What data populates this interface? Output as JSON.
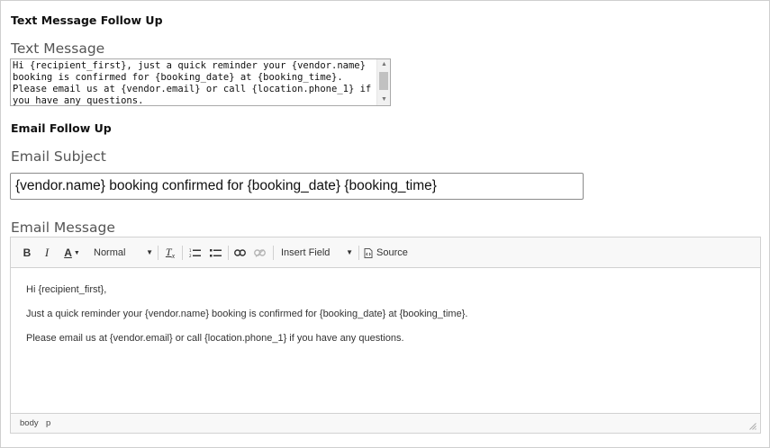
{
  "sms_section": {
    "heading": "Text Message Follow Up",
    "field_label": "Text Message",
    "value": "Hi {recipient_first}, just a quick reminder your {vendor.name} booking is confirmed for {booking_date} at {booking_time}. Please email us at {vendor.email} or call {location.phone_1} if you have any questions."
  },
  "email_section": {
    "heading": "Email Follow Up",
    "subject_label": "Email Subject",
    "subject_value": "{vendor.name} booking confirmed for {booking_date} {booking_time}",
    "message_label": "Email Message"
  },
  "editor": {
    "toolbar": {
      "bold": "B",
      "italic": "I",
      "font_color": "A",
      "format_value": "Normal",
      "remove_format": "Tx",
      "insert_field_value": "Insert Field",
      "source_label": "Source"
    },
    "paragraphs": [
      "Hi {recipient_first},",
      "Just a quick reminder your {vendor.name} booking is confirmed for {booking_date} at {booking_time}.",
      "Please email us at {vendor.email} or call {location.phone_1} if you have any questions."
    ],
    "statusbar": {
      "crumbs": [
        "body",
        "p"
      ]
    }
  },
  "icons": {
    "font_color": "text-color-icon",
    "remove_format": "remove-format-icon",
    "numbered_list": "numbered-list-icon",
    "bulleted_list": "bulleted-list-icon",
    "link": "link-icon",
    "unlink": "unlink-icon",
    "source": "source-icon",
    "resize": "resize-grip-icon"
  },
  "colors": {
    "toolbar_bg": "#f8f8f8",
    "border": "#d1d1d1",
    "label_gray": "#555555"
  }
}
